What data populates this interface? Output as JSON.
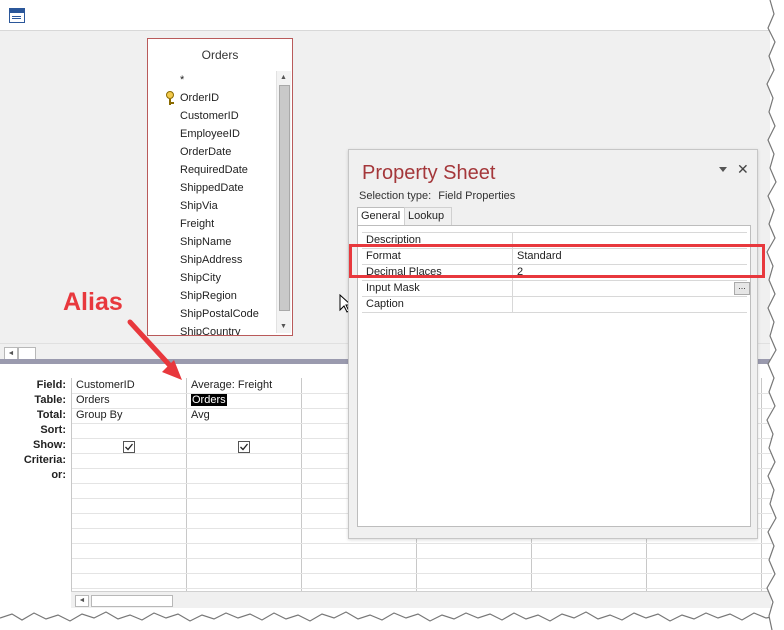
{
  "annotation": {
    "text": "Alias",
    "color": "#e8383d"
  },
  "table": {
    "title": "Orders",
    "fields": [
      "*",
      "OrderID",
      "CustomerID",
      "EmployeeID",
      "OrderDate",
      "RequiredDate",
      "ShippedDate",
      "ShipVia",
      "Freight",
      "ShipName",
      "ShipAddress",
      "ShipCity",
      "ShipRegion",
      "ShipPostalCode",
      "ShipCountry"
    ],
    "key_field": "OrderID",
    "border_color": "#b95a5a"
  },
  "grid": {
    "row_labels": [
      "Field:",
      "Table:",
      "Total:",
      "Sort:",
      "Show:",
      "Criteria:",
      "or:"
    ],
    "columns": [
      {
        "field": "CustomerID",
        "table": "Orders",
        "total": "Group By",
        "show": true
      },
      {
        "field": "Average: Freight",
        "table": "Orders",
        "total": "Avg",
        "show": true
      }
    ]
  },
  "property_sheet": {
    "title": "Property Sheet",
    "title_color": "#a4373a",
    "selection_label": "Selection type:",
    "selection_value": "Field Properties",
    "tabs": [
      "General",
      "Lookup"
    ],
    "active_tab": "General",
    "properties": [
      {
        "name": "Description",
        "value": ""
      },
      {
        "name": "Format",
        "value": "Standard"
      },
      {
        "name": "Decimal Places",
        "value": "2"
      },
      {
        "name": "Input Mask",
        "value": ""
      },
      {
        "name": "Caption",
        "value": ""
      }
    ],
    "builder_button": "...",
    "close_glyph": "✕"
  },
  "icons": {
    "app": "access-query-icon",
    "key": "primary-key-icon",
    "cursor": "mouse-pointer-icon",
    "arrow_left": "◄",
    "arrow_up": "▲",
    "arrow_down": "▼"
  }
}
